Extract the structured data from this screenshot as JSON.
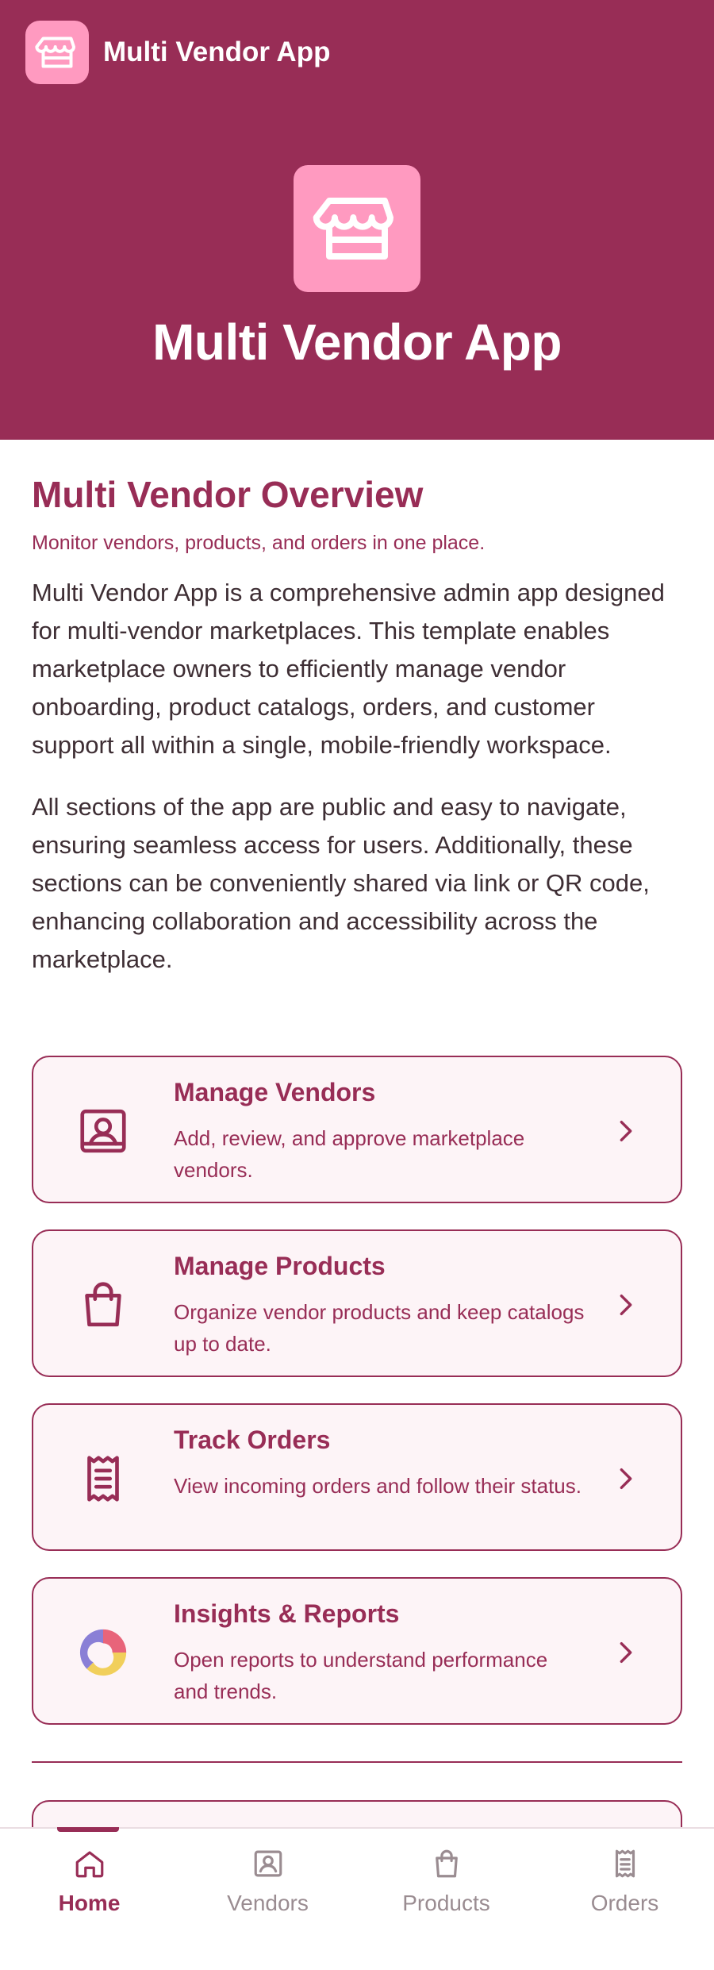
{
  "app": {
    "title": "Multi Vendor App",
    "hero_title": "Multi Vendor App"
  },
  "overview": {
    "title": "Multi Vendor Overview",
    "subtitle": "Monitor vendors, products, and orders in one place.",
    "paragraphs": [
      "Multi Vendor App is a comprehensive admin app designed for multi-vendor marketplaces. This template enables marketplace owners to efficiently manage vendor onboarding, product catalogs, orders, and customer support all within a single, mobile-friendly workspace.",
      "All sections of the app are public and easy to navigate, ensuring seamless access for users. Additionally, these sections can be conveniently shared via link or QR code, enhancing collaboration and accessibility across the marketplace."
    ]
  },
  "cards": [
    {
      "icon": "vendor-profile-icon",
      "title": "Manage Vendors",
      "description": "Add, review, and approve marketplace vendors."
    },
    {
      "icon": "shopping-bag-icon",
      "title": "Manage Products",
      "description": "Organize vendor products and keep catalogs up to date."
    },
    {
      "icon": "receipt-icon",
      "title": "Track Orders",
      "description": "View incoming orders and follow their status."
    },
    {
      "icon": "pie-chart-icon",
      "title": "Insights & Reports",
      "description": "Open reports to understand performance and trends."
    }
  ],
  "nav": {
    "items": [
      {
        "label": "Home",
        "icon": "home-icon",
        "active": true
      },
      {
        "label": "Vendors",
        "icon": "vendor-profile-icon",
        "active": false
      },
      {
        "label": "Products",
        "icon": "shopping-bag-icon",
        "active": false
      },
      {
        "label": "Orders",
        "icon": "receipt-icon",
        "active": false
      }
    ]
  },
  "colors": {
    "brand": "#982d56",
    "brand_light": "#ff9ac0",
    "card_bg": "#fdf4f7",
    "nav_inactive": "#9a8c91"
  }
}
